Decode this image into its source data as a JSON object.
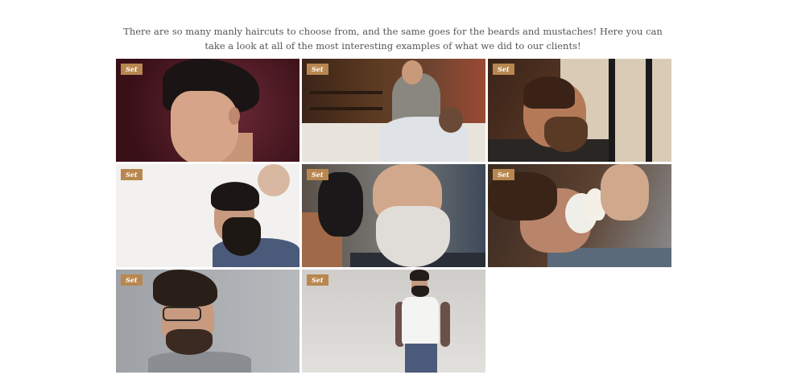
{
  "intro": {
    "text": "There are so many manly haircuts to choose from, and the same goes for the beards and mustaches! Here you can take a look at all of the most interesting examples of what we did to our clients!"
  },
  "gallery": {
    "badge_color": "#b8874f",
    "items": [
      {
        "badge": "Set",
        "photo": "man-pompadour-maroon-photo"
      },
      {
        "badge": "Set",
        "photo": "barber-shop-beard-trim-photo"
      },
      {
        "badge": "Set",
        "photo": "straight-razor-shave-photo"
      },
      {
        "badge": "Set",
        "photo": "bearded-man-haircut-profile-photo"
      },
      {
        "badge": "Set",
        "photo": "older-man-white-beard-photo"
      },
      {
        "badge": "Set",
        "photo": "shaving-foam-brush-photo"
      },
      {
        "badge": "Set",
        "photo": "smiling-man-glasses-photo"
      },
      {
        "badge": "Set",
        "photo": "man-white-tshirt-standing-photo"
      }
    ]
  }
}
